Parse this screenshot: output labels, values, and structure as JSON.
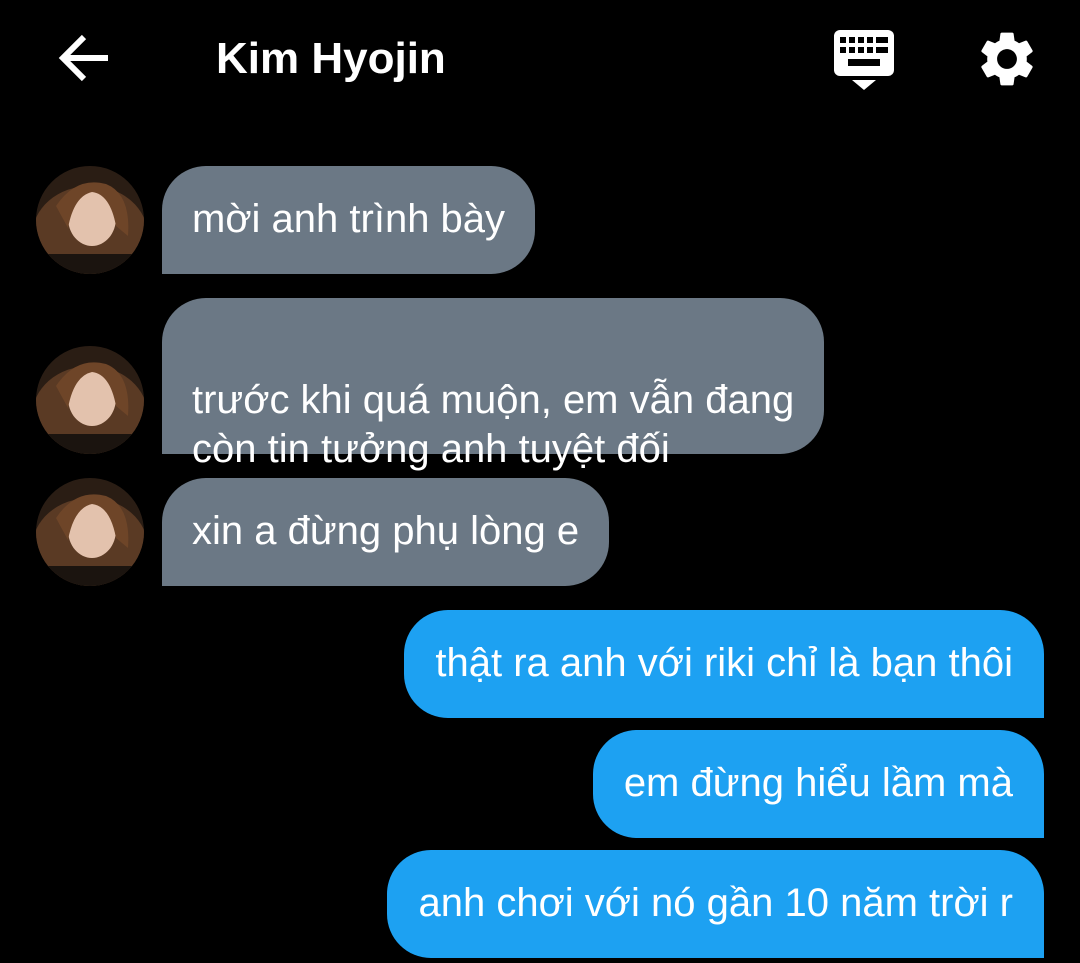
{
  "header": {
    "title": "Kim Hyojin",
    "back_icon": "arrow-left-icon",
    "keyboard_icon": "keyboard-icon",
    "settings_icon": "gear-icon"
  },
  "messages": [
    {
      "direction": "incoming",
      "text": "mời anh trình bày"
    },
    {
      "direction": "incoming",
      "text": "trước khi quá muộn, em vẫn đang\ncòn tin tưởng anh tuyệt đối"
    },
    {
      "direction": "incoming",
      "text": "xin a đừng phụ lòng e"
    },
    {
      "direction": "outgoing",
      "text": "thật ra anh với riki chỉ là bạn thôi"
    },
    {
      "direction": "outgoing",
      "text": "em đừng hiểu lầm mà"
    },
    {
      "direction": "outgoing",
      "text": "anh chơi với nó gần 10 năm trời r"
    }
  ],
  "colors": {
    "background": "#000000",
    "incoming_bubble": "#6b7885",
    "outgoing_bubble": "#1da1f2",
    "text": "#ffffff"
  }
}
